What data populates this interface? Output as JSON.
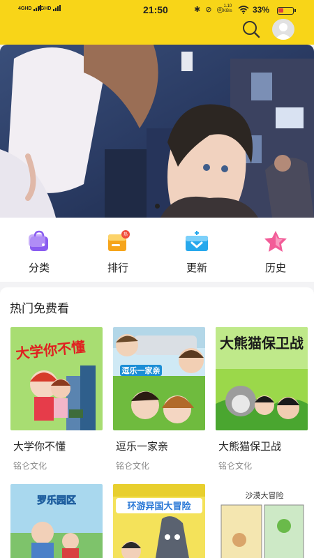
{
  "status_bar": {
    "signal_left": "4GHD",
    "signal_right": "4GHD",
    "time": "21:50",
    "icons": "✱ ⊘ ◎",
    "speed_value": "1.10",
    "speed_unit": "KB/s",
    "battery": "33%"
  },
  "banner": {
    "slide_count": 1,
    "active_slide": 1
  },
  "categories": [
    {
      "label": "分类",
      "icon": "shopping-bag-icon",
      "color": "#8a5cf0"
    },
    {
      "label": "排行",
      "icon": "ranking-box-icon",
      "color": "#f6a51b",
      "badge": "热"
    },
    {
      "label": "更新",
      "icon": "update-box-icon",
      "color": "#27a8ec"
    },
    {
      "label": "历史",
      "icon": "star-history-icon",
      "color": "#f25c98"
    }
  ],
  "hot_section": {
    "title": "热门免费看",
    "items": [
      {
        "title": "大学你不懂",
        "publisher": "铭仑文化",
        "cover_text": "大学你不懂"
      },
      {
        "title": "逗乐一家亲",
        "publisher": "铭仑文化",
        "cover_text": "逗乐一家亲"
      },
      {
        "title": "大熊猫保卫战",
        "publisher": "铭仑文化",
        "cover_text": "大熊猫保卫战"
      }
    ],
    "items_row2": [
      {
        "cover_text": "罗乐园区"
      },
      {
        "cover_text": "环游异国大冒险"
      },
      {
        "cover_text": "沙漠大冒险"
      }
    ]
  },
  "colors": {
    "topbar": "#f8d518",
    "background": "#f3f3f5",
    "text": "#222222",
    "muted": "#888888"
  }
}
